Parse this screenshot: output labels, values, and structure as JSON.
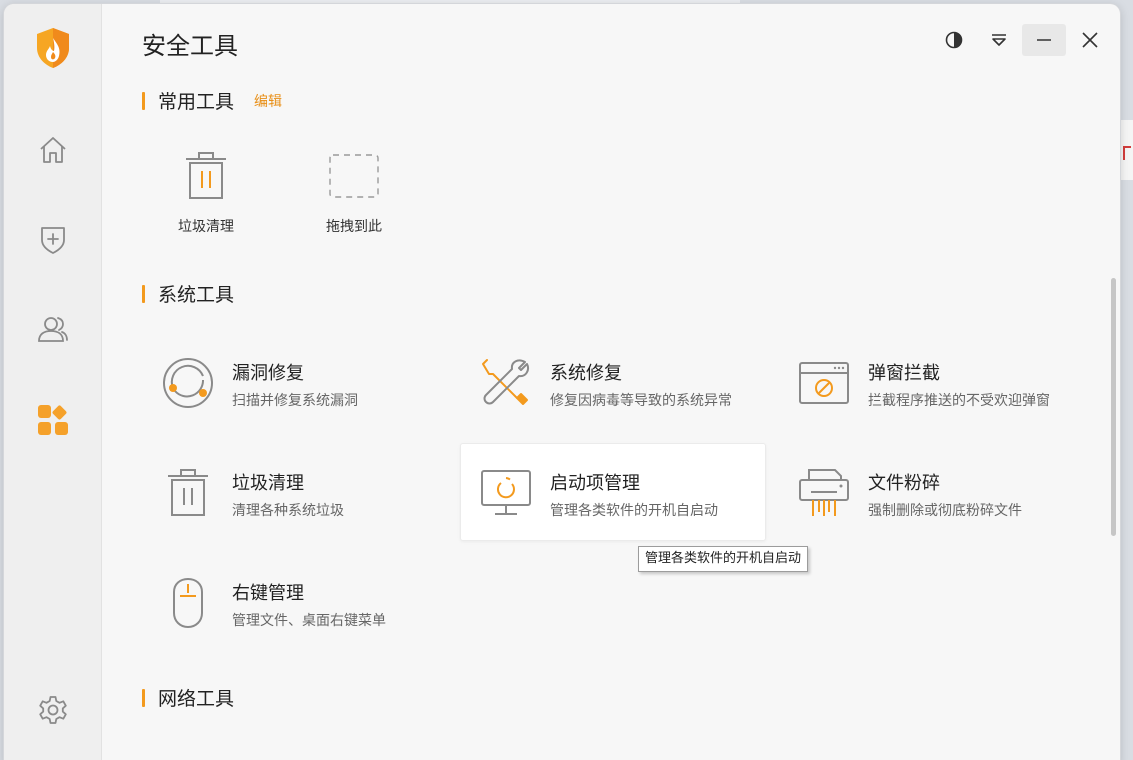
{
  "window": {
    "title": "安全工具"
  },
  "sidebar": {
    "items": [
      {
        "icon": "home-icon"
      },
      {
        "icon": "shield-plus-icon"
      },
      {
        "icon": "users-icon"
      },
      {
        "icon": "apps-icon",
        "active": true
      },
      {
        "icon": "gear-icon"
      }
    ]
  },
  "sections": {
    "common": {
      "label": "常用工具",
      "edit": "编辑"
    },
    "system": {
      "label": "系统工具"
    },
    "network": {
      "label": "网络工具"
    }
  },
  "quick_tools": [
    {
      "label": "垃圾清理",
      "icon": "trash-icon"
    },
    {
      "label": "拖拽到此",
      "icon": "drop-slot-icon"
    }
  ],
  "tools": [
    {
      "name": "漏洞修复",
      "desc": "扫描并修复系统漏洞",
      "icon": "vulnerability-icon"
    },
    {
      "name": "系统修复",
      "desc": "修复因病毒等导致的系统异常",
      "icon": "repair-tools-icon"
    },
    {
      "name": "弹窗拦截",
      "desc": "拦截程序推送的不受欢迎弹窗",
      "icon": "popup-block-icon"
    },
    {
      "name": "垃圾清理",
      "desc": "清理各种系统垃圾",
      "icon": "trash-icon"
    },
    {
      "name": "启动项管理",
      "desc": "管理各类软件的开机自启动",
      "icon": "startup-monitor-icon"
    },
    {
      "name": "文件粉碎",
      "desc": "强制删除或彻底粉碎文件",
      "icon": "shredder-icon"
    },
    {
      "name": "右键管理",
      "desc": "管理文件、桌面右键菜单",
      "icon": "mouse-icon"
    }
  ],
  "tooltip": {
    "text": "管理各类软件的开机自启动"
  },
  "colors": {
    "accent": "#f39a1e",
    "icon_gray": "#8a8a8a",
    "active_nav": "#f5a12a"
  }
}
